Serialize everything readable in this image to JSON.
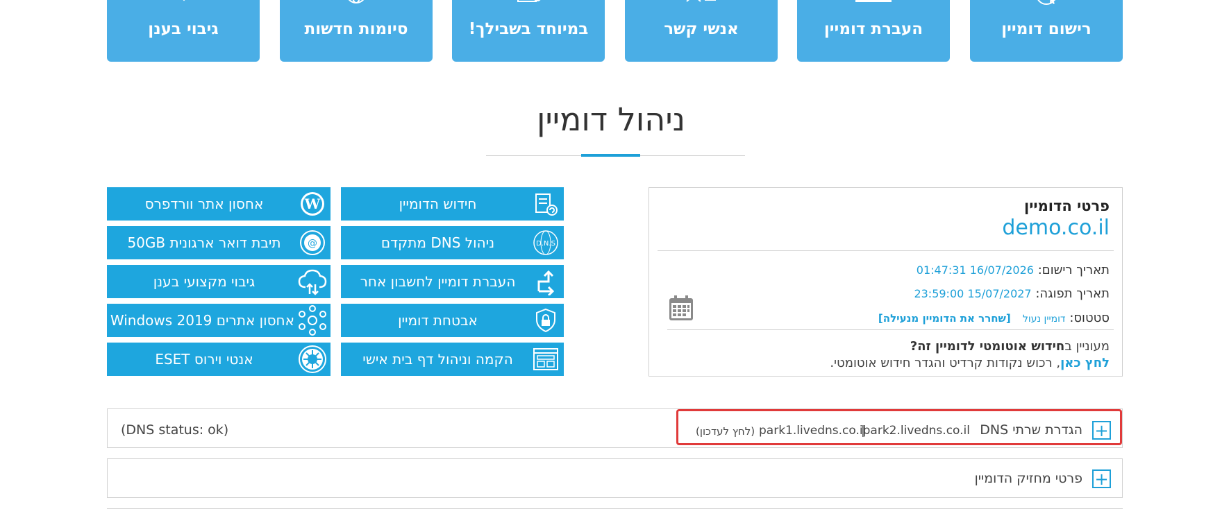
{
  "top_tiles": [
    {
      "label": "רישום דומיין",
      "icon": "globe-cursor-icon"
    },
    {
      "label": "העברת דומיין",
      "icon": "laptop-icon"
    },
    {
      "label": "אנשי קשר",
      "icon": "contacts-icon"
    },
    {
      "label": "במיוחד בשבילך!",
      "icon": "gift-icon"
    },
    {
      "label": "סיומות חדשות",
      "icon": "globe-icon"
    },
    {
      "label": "גיבוי בענן",
      "icon": "cloud-sync-icon"
    }
  ],
  "page_title": "ניהול דומיין",
  "services": [
    {
      "label": "חידוש הדומיין",
      "icon": "renew-document-icon"
    },
    {
      "label": "ניהול DNS מתקדם",
      "icon": "dns-globe-icon"
    },
    {
      "label": "העברת דומיין לחשבון אחר",
      "icon": "transfer-arrows-icon"
    },
    {
      "label": "אבטחת דומיין",
      "icon": "shield-lock-icon"
    },
    {
      "label": "הקמה וניהול דף בית אישי",
      "icon": "webpage-icon"
    },
    {
      "label": "אחסון אתר וורדפרס",
      "icon": "wordpress-icon"
    },
    {
      "label": "תיבת דואר ארגונית 50GB",
      "icon": "at-sign-icon"
    },
    {
      "label": "גיבוי מקצועי בענן",
      "icon": "cloud-upload-icon"
    },
    {
      "label": "אחסון אתרים Windows 2019",
      "icon": "network-nodes-icon"
    },
    {
      "label": "אנטי וירוס ESET",
      "icon": "virus-icon"
    }
  ],
  "details": {
    "title": "פרטי הדומיין",
    "domain": "demo.co.il",
    "reg_label": "תאריך רישום:",
    "reg_value": "16/07/2026 01:47:31",
    "exp_label": "תאריך תפוגה:",
    "exp_value": "15/07/2027 23:59:00",
    "status_label": "סטטוס:",
    "status_value": "דומיין נעול",
    "status_link": "[שחרר את הדומיין מנעילה]",
    "renew_prefix": "מעוניין ב",
    "renew_bold": "חידוש אוטומטי לדומיין זה?",
    "renew_link": "לחץ כאן",
    "renew_rest": ", רכוש נקודות קרדיט והגדר חידוש אוטומטי."
  },
  "dns": {
    "label": "הגדרת שרתי DNS",
    "ns2": "park2.livedns.co.il",
    "separator": "|",
    "ns1": "park1.livedns.co.il",
    "update_link": "(לחץ לעדכון)",
    "status": "(DNS status: ok)"
  },
  "holder": {
    "label": "פרטי מחזיק הדומיין"
  },
  "colors": {
    "tile_blue": "#4aaee6",
    "button_blue": "#1ea6de",
    "link_blue": "#1ea0d8",
    "highlight_red": "#e03a3a"
  }
}
